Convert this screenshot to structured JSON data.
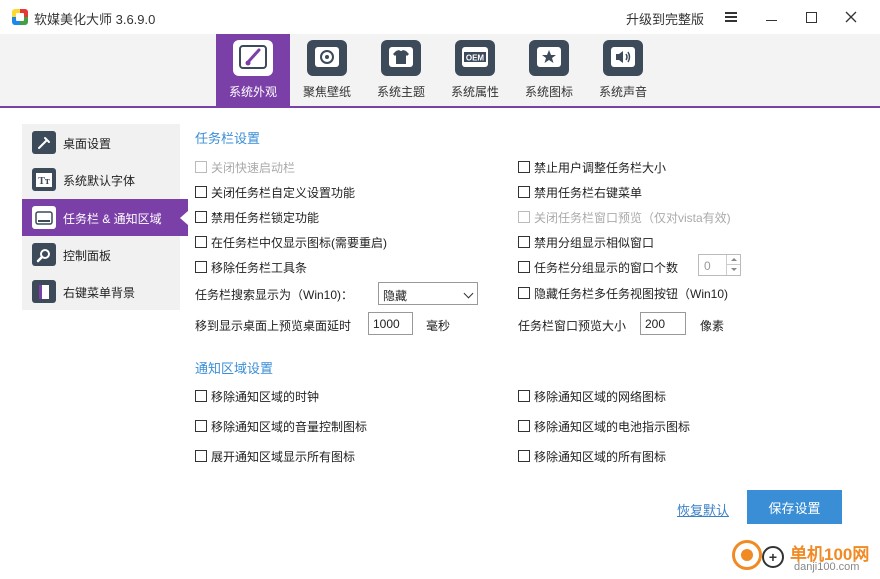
{
  "app": {
    "title": "软媒美化大师 3.6.9.0",
    "upgrade_label": "升级到完整版"
  },
  "tabs": [
    {
      "label": "系统外观",
      "icon": "brush-icon",
      "active": true
    },
    {
      "label": "聚焦壁纸",
      "icon": "focus-wallpaper-icon",
      "active": false
    },
    {
      "label": "系统主题",
      "icon": "tshirt-icon",
      "active": false
    },
    {
      "label": "系统属性",
      "icon": "oem-icon",
      "active": false
    },
    {
      "label": "系统图标",
      "icon": "star-icon",
      "active": false
    },
    {
      "label": "系统声音",
      "icon": "speaker-icon",
      "active": false
    }
  ],
  "sidebar": {
    "items": [
      {
        "label": "桌面设置",
        "icon": "desktop-settings-icon",
        "active": false
      },
      {
        "label": "系统默认字体",
        "icon": "font-icon",
        "active": false
      },
      {
        "label": "任务栏 & 通知区域",
        "icon": "taskbar-icon",
        "active": true
      },
      {
        "label": "控制面板",
        "icon": "control-panel-icon",
        "active": false
      },
      {
        "label": "右键菜单背景",
        "icon": "context-menu-icon",
        "active": false
      }
    ]
  },
  "taskbar": {
    "title": "任务栏设置",
    "left": [
      {
        "label": "关闭快速启动栏",
        "disabled": true
      },
      {
        "label": "关闭任务栏自定义设置功能",
        "disabled": false
      },
      {
        "label": "禁用任务栏锁定功能",
        "disabled": false
      },
      {
        "label": "在任务栏中仅显示图标(需要重启)",
        "disabled": false
      },
      {
        "label": "移除任务栏工具条",
        "disabled": false
      }
    ],
    "right": [
      {
        "label": "禁止用户调整任务栏大小",
        "disabled": false
      },
      {
        "label": "禁用任务栏右键菜单",
        "disabled": false
      },
      {
        "label": "关闭任务栏窗口预览（仅对vista有效)",
        "disabled": true
      },
      {
        "label": "禁用分组显示相似窗口",
        "disabled": false
      },
      {
        "label": "任务栏分组显示的窗口个数",
        "disabled": false
      },
      {
        "label": "隐藏任务栏多任务视图按钮（Win10)",
        "disabled": false
      }
    ],
    "search_label": "任务栏搜索显示为（Win10)：",
    "search_value": "隐藏",
    "group_count": "0",
    "delay_label": "移到显示桌面上预览桌面延时",
    "delay_value": "1000",
    "delay_unit": "毫秒",
    "preview_size_label": "任务栏窗口预览大小",
    "preview_size_value": "200",
    "preview_size_unit": "像素"
  },
  "notify": {
    "title": "通知区域设置",
    "left": [
      {
        "label": "移除通知区域的时钟"
      },
      {
        "label": "移除通知区域的音量控制图标"
      },
      {
        "label": "展开通知区域显示所有图标"
      }
    ],
    "right": [
      {
        "label": "移除通知区域的网络图标"
      },
      {
        "label": "移除通知区域的电池指示图标"
      },
      {
        "label": "移除通知区域的所有图标"
      }
    ]
  },
  "actions": {
    "restore_label": "恢复默认",
    "save_label": "保存设置"
  },
  "watermark": {
    "site_name": "单机100网",
    "site_url": "danji100.com"
  },
  "colors": {
    "accent": "#7b3fa8",
    "link": "#3a8ed6",
    "icon_bg": "#3c4a5a"
  }
}
